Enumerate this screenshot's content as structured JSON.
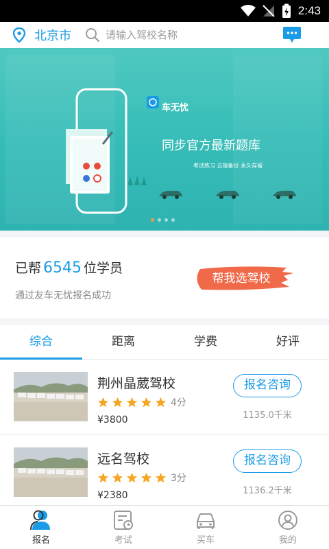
{
  "status_bar": {
    "time": "2:43"
  },
  "header": {
    "city": "北京市",
    "search_placeholder": "请输入驾校名称"
  },
  "banner": {
    "brand": "车无忧",
    "tagline": "同步官方最新题库",
    "subtag": "考试练习  云端备份  永久存留",
    "slides": 4,
    "active_slide": 1
  },
  "stats": {
    "prefix": "已帮",
    "count": "6545",
    "suffix": "位学员",
    "subtitle": "通过友车无忧报名成功",
    "help_button": "帮我选驾校"
  },
  "tabs": [
    {
      "label": "综合",
      "active": true
    },
    {
      "label": "距离",
      "active": false
    },
    {
      "label": "学费",
      "active": false
    },
    {
      "label": "好评",
      "active": false
    }
  ],
  "schools": [
    {
      "name": "荆州晶葳驾校",
      "stars": 5,
      "score": "4分",
      "price": "¥3800",
      "distance": "1135.0千米",
      "consult_label": "报名咨询"
    },
    {
      "name": "远名驾校",
      "stars": 5,
      "score": "3分",
      "price": "¥2380",
      "distance": "1136.2千米",
      "consult_label": "报名咨询"
    }
  ],
  "bottom_nav": [
    {
      "label": "报名",
      "icon": "signup-user-icon",
      "active": true
    },
    {
      "label": "考试",
      "icon": "exam-schedule-icon",
      "active": false
    },
    {
      "label": "买车",
      "icon": "car-icon",
      "active": false
    },
    {
      "label": "我的",
      "icon": "profile-icon",
      "active": false
    }
  ],
  "colors": {
    "accent": "#1a9be6",
    "banner": "#3cc0ba",
    "help_button": "#f06a4a",
    "star": "#f5a623"
  }
}
